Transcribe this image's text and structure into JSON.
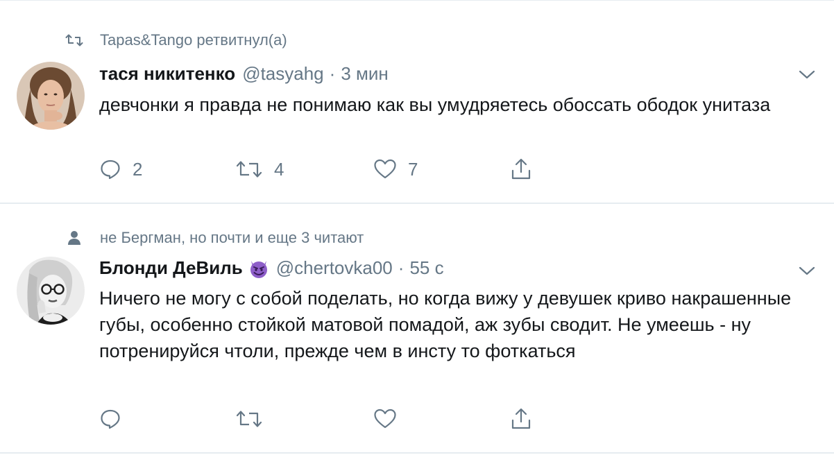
{
  "tweets": [
    {
      "context_text": "Tapas&Tango ретвитнул(а)",
      "context_icon": "retweet-icon",
      "name": "тася никитенко",
      "handle": "@tasyahg",
      "separator": "·",
      "time": "3 мин",
      "text": "девчонки я правда не понимаю как вы умудряетесь обоссать ободок унитаза",
      "reply_count": "2",
      "retweet_count": "4",
      "like_count": "7"
    },
    {
      "context_text": "не Бергман, но почти и еще 3 читают",
      "context_icon": "person-icon",
      "name": "Блонди ДеВиль",
      "name_emoji": "smiling-devil-emoji",
      "handle": "@chertovka00",
      "separator": "·",
      "time": "55 с",
      "text": "Ничего не могу с собой поделать, но когда вижу у девушек криво накрашенные губы, особенно стойкой матовой помадой, аж зубы сводит. Не умеешь - ну потренируйся чтоли, прежде чем в инсту то фоткаться",
      "reply_count": "",
      "retweet_count": "",
      "like_count": ""
    }
  ],
  "colors": {
    "text_primary": "#14171a",
    "text_secondary": "#657786",
    "divider": "#e6ecf0",
    "emoji_purple": "#8e5ec9"
  }
}
